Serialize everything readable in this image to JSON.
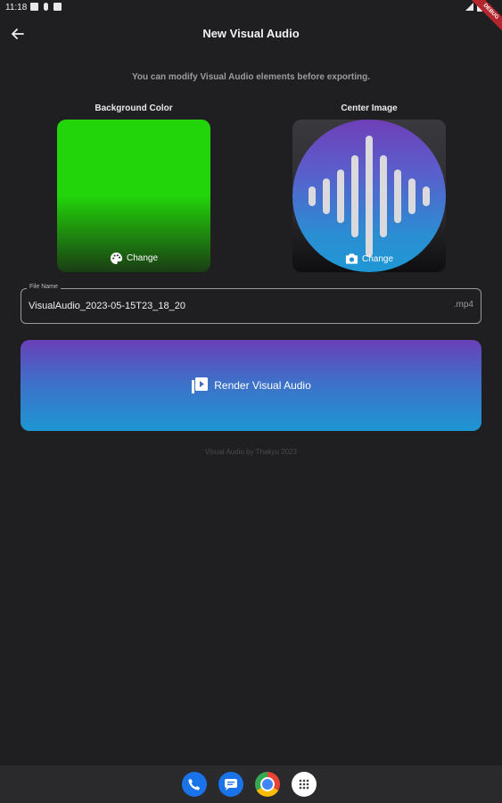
{
  "status_bar": {
    "time": "11:18"
  },
  "debug_banner": "DEBUG",
  "app_bar": {
    "title": "New Visual Audio"
  },
  "subtitle": "You can modify Visual Audio elements before exporting.",
  "background_tile": {
    "label": "Background Color",
    "change_label": "Change",
    "color": "#22d40a"
  },
  "center_tile": {
    "label": "Center Image",
    "change_label": "Change"
  },
  "file_name": {
    "label": "File Name",
    "value": "VisualAudio_2023-05-15T23_18_20",
    "extension": ".mp4"
  },
  "render_button": {
    "label": "Render Visual Audio"
  },
  "footer": {
    "credit": "Visual Audio by Thakyu 2023"
  },
  "dock": {
    "icons": [
      "phone-icon",
      "messages-icon",
      "chrome-icon",
      "app-drawer-icon"
    ]
  },
  "colors": {
    "background": "#1f1f22",
    "accent_top": "#6a3fb8",
    "accent_bottom": "#1d96d2"
  }
}
